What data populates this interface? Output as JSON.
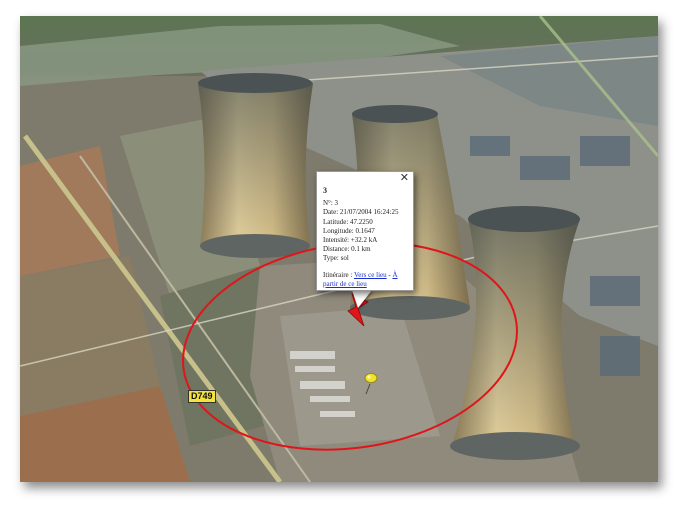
{
  "map": {
    "road_label": "D749",
    "icons": [
      "lightning-marker-icon",
      "yellow-pushpin-icon"
    ],
    "colors": {
      "radius_circle": "#e0151a",
      "lightning_marker": "#e0151a",
      "pushpin": "#f2e22a",
      "road_label_bg": "#f3e33a"
    }
  },
  "popup": {
    "close_label": "✕",
    "title": "3",
    "fields": {
      "number": "N°: 3",
      "date": "Date: 21/07/2004 16:24:25",
      "latitude": "Latitude: 47.2250",
      "longitude": "Longitude: 0.1647",
      "intensity": "Intensité: +32.2 kA",
      "distance": "Distance: 0.1 km",
      "type": "Type: sol"
    },
    "itinerary": {
      "label": "Itinéraire : ",
      "to_link": "Vers ce lieu",
      "separator": " - ",
      "from_link": "À partir de ce lieu"
    }
  }
}
